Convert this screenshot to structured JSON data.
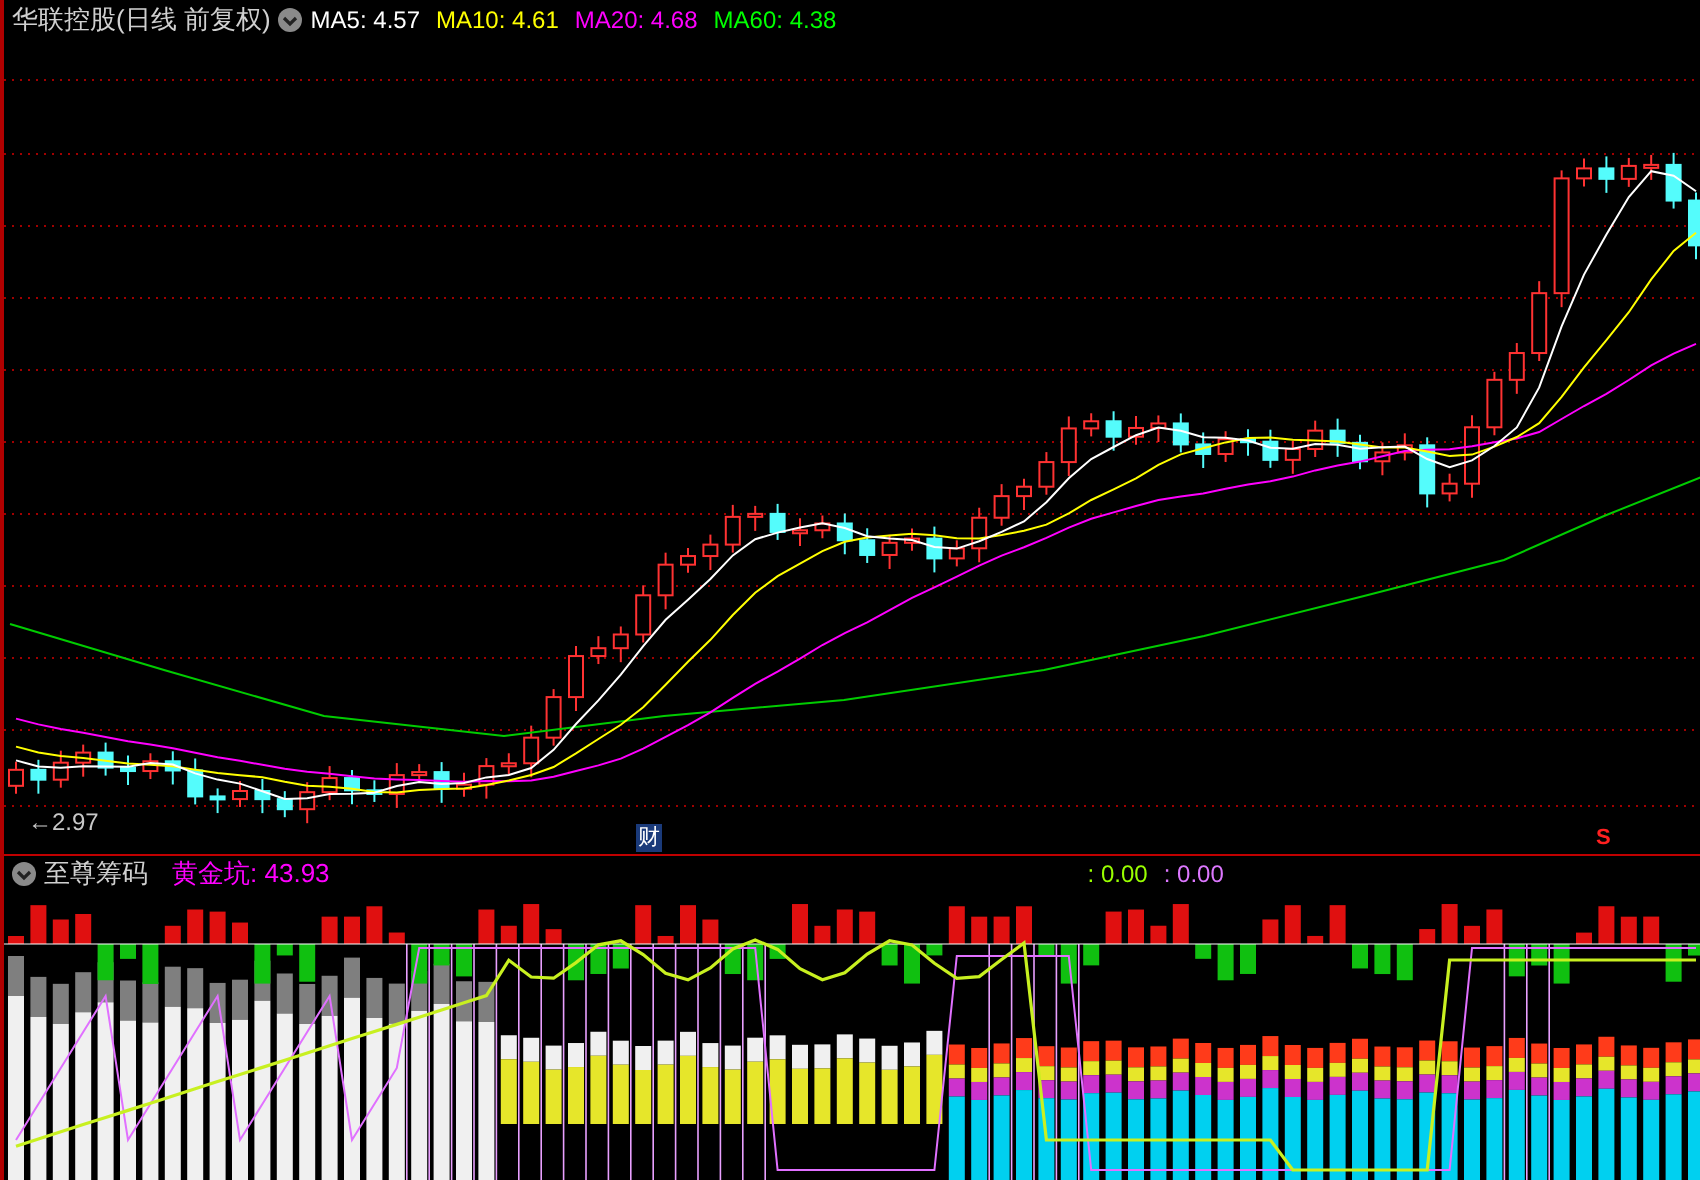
{
  "title": "华联控股(日线 前复权)",
  "moving_averages": [
    {
      "label": "MA5:",
      "value": "4.57",
      "color": "#ffffff"
    },
    {
      "label": "MA10:",
      "value": "4.61",
      "color": "#ffff00"
    },
    {
      "label": "MA20:",
      "value": "4.68",
      "color": "#ff00ff"
    },
    {
      "label": "MA60:",
      "value": "4.38",
      "color": "#00ff00"
    }
  ],
  "price_marker": "←2.97",
  "finance_badge": "财",
  "signal_mark": "S",
  "indicator": {
    "name": "至尊筹码",
    "readings": [
      {
        "label": "黄金坑:",
        "value": "43.93",
        "color": "#ff00ff"
      },
      {
        "label": ":",
        "value": "0.00",
        "color": "#99ff00"
      },
      {
        "label": ":",
        "value": "0.00",
        "color": "#dd77ff"
      }
    ]
  }
}
